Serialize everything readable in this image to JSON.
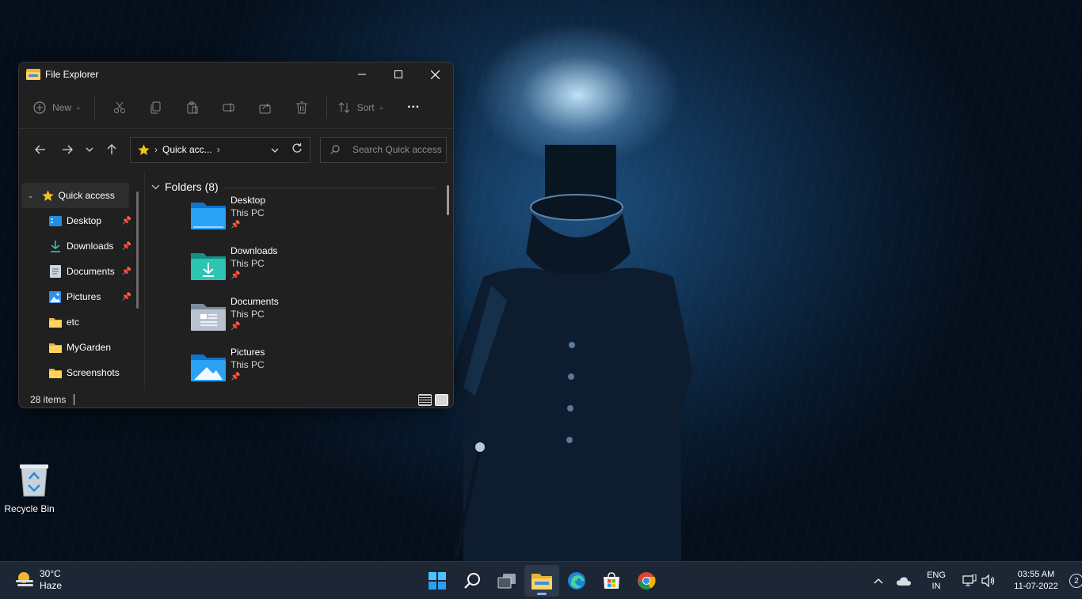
{
  "window": {
    "title": "File Explorer",
    "controls": [
      "minimize",
      "maximize",
      "close"
    ]
  },
  "toolbar": {
    "new_label": "New",
    "sort_label": "Sort"
  },
  "navbar": {
    "address": "Quick acc...",
    "search_placeholder": "Search Quick access"
  },
  "sidebar": {
    "items": [
      {
        "label": "Quick access",
        "icon": "star-icon",
        "pinned": false
      },
      {
        "label": "Desktop",
        "icon": "desktop-folder-icon",
        "pinned": true
      },
      {
        "label": "Downloads",
        "icon": "download-icon",
        "pinned": true
      },
      {
        "label": "Documents",
        "icon": "documents-icon",
        "pinned": true
      },
      {
        "label": "Pictures",
        "icon": "pictures-icon",
        "pinned": true
      },
      {
        "label": "etc",
        "icon": "folder-icon",
        "pinned": false
      },
      {
        "label": "MyGarden",
        "icon": "folder-icon",
        "pinned": false
      },
      {
        "label": "Screenshots",
        "icon": "folder-icon",
        "pinned": false
      }
    ]
  },
  "main": {
    "group_title": "Folders (8)",
    "folders": [
      {
        "name": "Desktop",
        "location": "This PC"
      },
      {
        "name": "Downloads",
        "location": "This PC"
      },
      {
        "name": "Documents",
        "location": "This PC"
      },
      {
        "name": "Pictures",
        "location": "This PC"
      }
    ]
  },
  "status": {
    "items": "28 items"
  },
  "desktop": {
    "recycle_bin": "Recycle Bin"
  },
  "taskbar": {
    "weather_temp": "30°C",
    "weather_desc": "Haze",
    "lang_top": "ENG",
    "lang_bottom": "IN",
    "time": "03:55 AM",
    "date": "11-07-2022",
    "notifications": "2"
  },
  "colors": {
    "accent": "#4aa3ff",
    "folder_yellow": "#ffd35c",
    "window_bg": "#202020",
    "taskbar_bg": "#1c2634"
  }
}
